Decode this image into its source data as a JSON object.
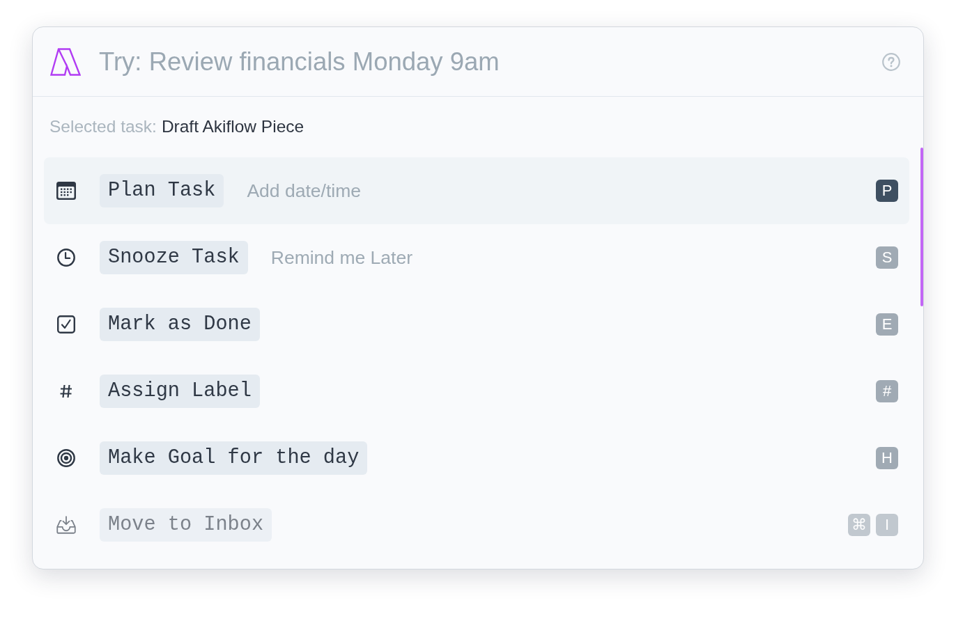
{
  "search": {
    "placeholder": "Try: Review financials Monday 9am"
  },
  "selected_task": {
    "label": "Selected task:",
    "value": "Draft Akiflow Piece"
  },
  "actions": [
    {
      "label": "Plan Task",
      "hint": "Add date/time",
      "keys": [
        "P"
      ],
      "selected": true,
      "dimmed": false
    },
    {
      "label": "Snooze Task",
      "hint": "Remind me Later",
      "keys": [
        "S"
      ],
      "selected": false,
      "dimmed": false
    },
    {
      "label": "Mark as Done",
      "keys": [
        "E"
      ],
      "selected": false,
      "dimmed": false
    },
    {
      "label": "Assign Label",
      "keys": [
        "#"
      ],
      "selected": false,
      "dimmed": false
    },
    {
      "label": "Make Goal for the day",
      "keys": [
        "H"
      ],
      "selected": false,
      "dimmed": false
    },
    {
      "label": "Move to Inbox",
      "keys": [
        "⌘",
        "I"
      ],
      "selected": false,
      "dimmed": true
    }
  ]
}
